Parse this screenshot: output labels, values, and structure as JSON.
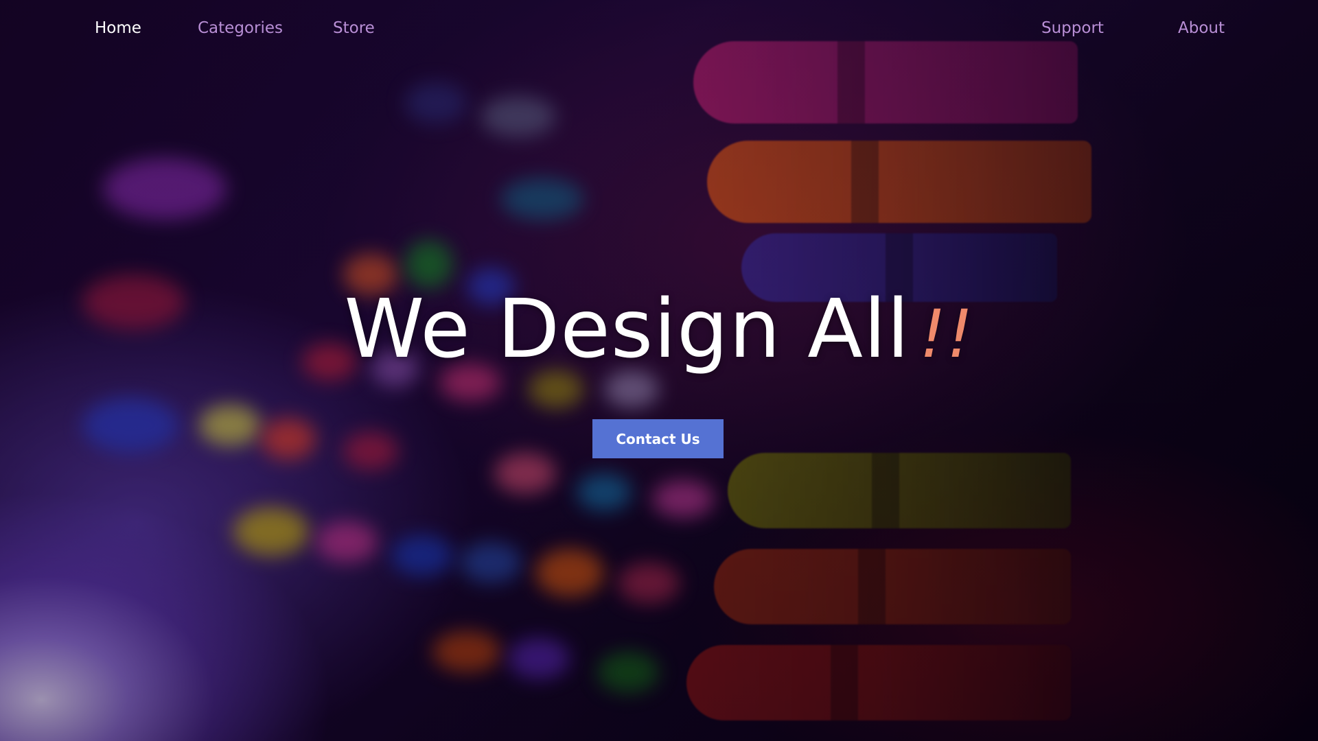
{
  "nav": {
    "items": [
      {
        "label": "Home",
        "active": true
      },
      {
        "label": "Categories",
        "active": false
      },
      {
        "label": "Store",
        "active": false
      },
      {
        "label": "Support",
        "active": false
      },
      {
        "label": "About",
        "active": false
      }
    ]
  },
  "hero": {
    "title": "We Design All",
    "title_accent": "!!",
    "cta_label": "Contact Us"
  },
  "colors": {
    "nav_active": "#ffffff",
    "nav_inactive": "#b98fd6",
    "accent": "#ef8a6b",
    "button_bg": "#5572d3"
  }
}
